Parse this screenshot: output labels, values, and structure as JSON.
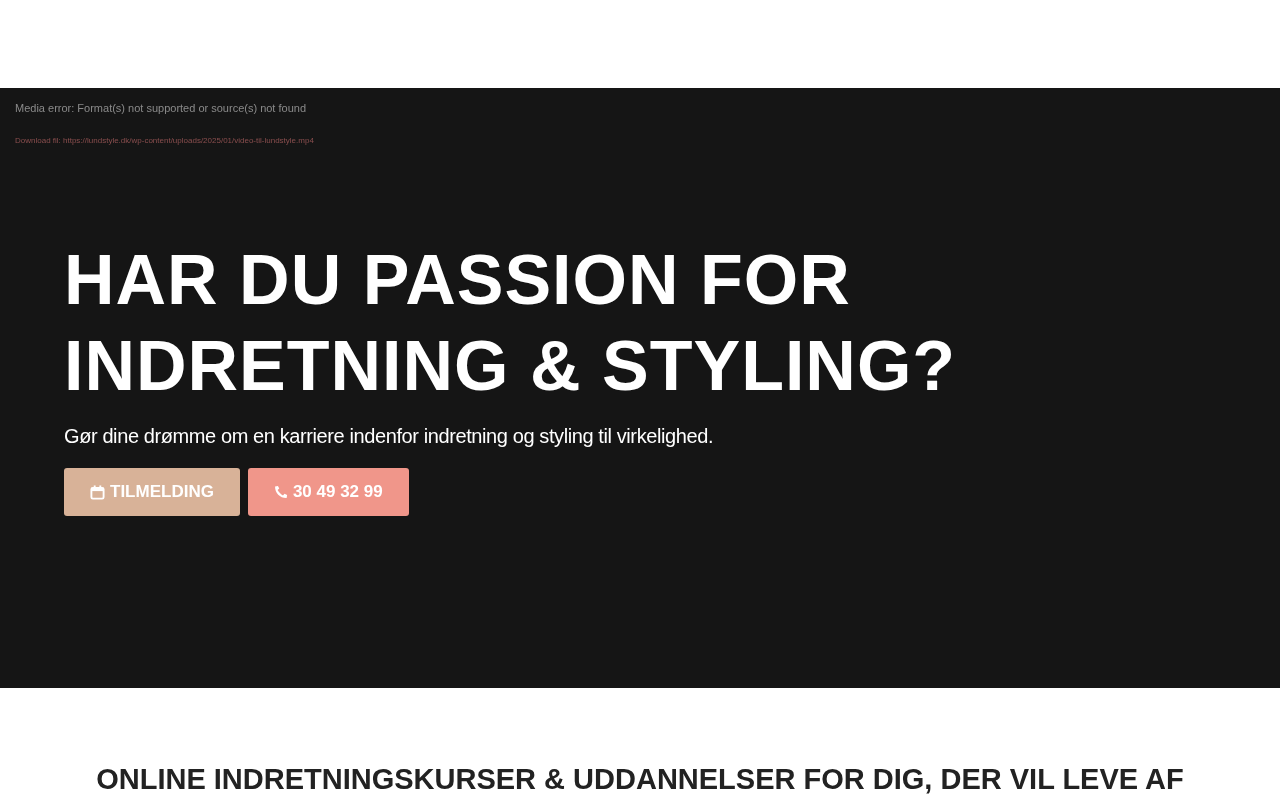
{
  "video": {
    "error": "Media error: Format(s) not supported or source(s) not found",
    "download_link": "Download fil: https://lundstyle.dk/wp-content/uploads/2025/01/video-til-lundstyle.mp4"
  },
  "hero": {
    "title_lines": [
      "HAR DU PASSION FOR",
      "INDRETNING & STYLING?"
    ],
    "subtitle": "Gør dine drømme om en karriere indenfor indretning og styling til virkelighed.",
    "buttons": [
      {
        "label": "TILMELDING",
        "kind": "calendar",
        "color": "#d8b298"
      },
      {
        "label": "30 49 32 99",
        "kind": "phone",
        "color": "#f0968a"
      }
    ]
  },
  "section": {
    "heading": "ONLINE INDRETNINGSKURSER & UDDANNELSER FOR DIG, DER VIL LEVE AF"
  }
}
